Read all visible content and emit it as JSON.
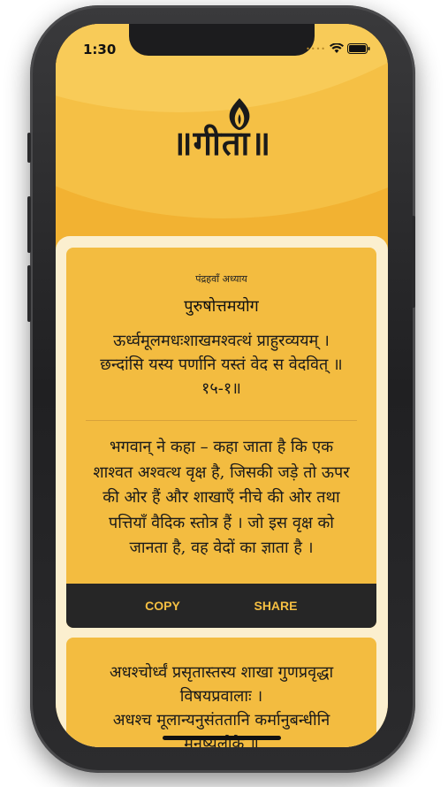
{
  "status_bar": {
    "time": "1:30"
  },
  "header": {
    "logo_text": "॥गीता॥"
  },
  "cards": [
    {
      "chapter_number": "पंद्रहवाँ अध्याय",
      "chapter_name": "पुरुषोत्तमयोग",
      "verse": [
        "ऊर्ध्वमूलमधःशाखमश्वत्थं प्राहुरव्ययम् ।",
        "छन्दांसि यस्य पर्णानि यस्तं वेद स वेदवित् ॥",
        "१५-१॥"
      ],
      "meaning": [
        "भगवान् ने कहा – कहा जाता है कि एक",
        "शाश्वत अश्वत्थ वृक्ष है, जिसकी जड़े तो ऊपर",
        "की ओर हैं और शाखाएँ नीचे की ओर तथा",
        "पत्तियाँ वैदिक स्तोत्र हैं । जो इस वृक्ष को",
        "जानता है, वह वेदों का ज्ञाता है ।"
      ],
      "copy_label": "COPY",
      "share_label": "SHARE"
    },
    {
      "verse": [
        "अधश्चोर्ध्वं प्रसृतास्तस्य शाखा गुणप्रवृद्धा",
        "विषयप्रवालाः ।",
        "अधश्च मूलान्यनुसंततानि कर्मानुबन्धीनि",
        "मनुष्यलोके ॥"
      ]
    }
  ]
}
